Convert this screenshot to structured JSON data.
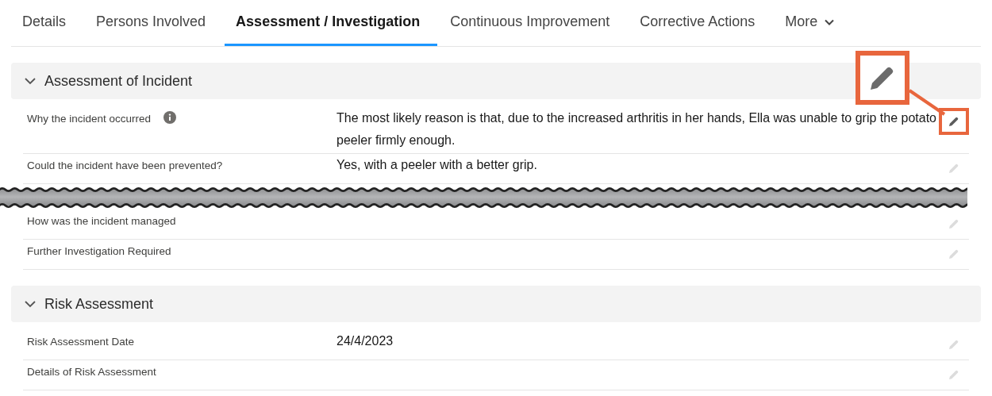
{
  "tabs": [
    {
      "label": "Details",
      "selected": false
    },
    {
      "label": "Persons Involved",
      "selected": false
    },
    {
      "label": "Assessment / Investigation",
      "selected": true
    },
    {
      "label": "Continuous Improvement",
      "selected": false
    },
    {
      "label": "Corrective Actions",
      "selected": false
    }
  ],
  "more_tab": {
    "label": "More"
  },
  "sections": [
    {
      "title": "Assessment of Incident",
      "expanded": true,
      "fields": [
        {
          "label": "Why the incident occurred",
          "info": true,
          "value": "The most likely reason is that, due to the increased arthritis in her hands, Ella was unable to grip the potato peeler firmly enough.",
          "highlighted": true
        },
        {
          "label": "Could the incident have been prevented?",
          "info": false,
          "value": "Yes, with a peeler with a better grip.",
          "highlighted": false
        },
        {
          "kind": "tear"
        },
        {
          "label": "How was the incident managed",
          "info": false,
          "highlighted": false
        },
        {
          "label": "Further Investigation Required",
          "info": false,
          "highlighted": false
        }
      ]
    },
    {
      "title": "Risk Assessment",
      "expanded": true,
      "fields": [
        {
          "label": "Risk Assessment Date",
          "info": false,
          "value": "24/4/2023",
          "highlighted": false
        },
        {
          "label": "Details of Risk Assessment",
          "info": false,
          "highlighted": false
        }
      ]
    }
  ]
}
